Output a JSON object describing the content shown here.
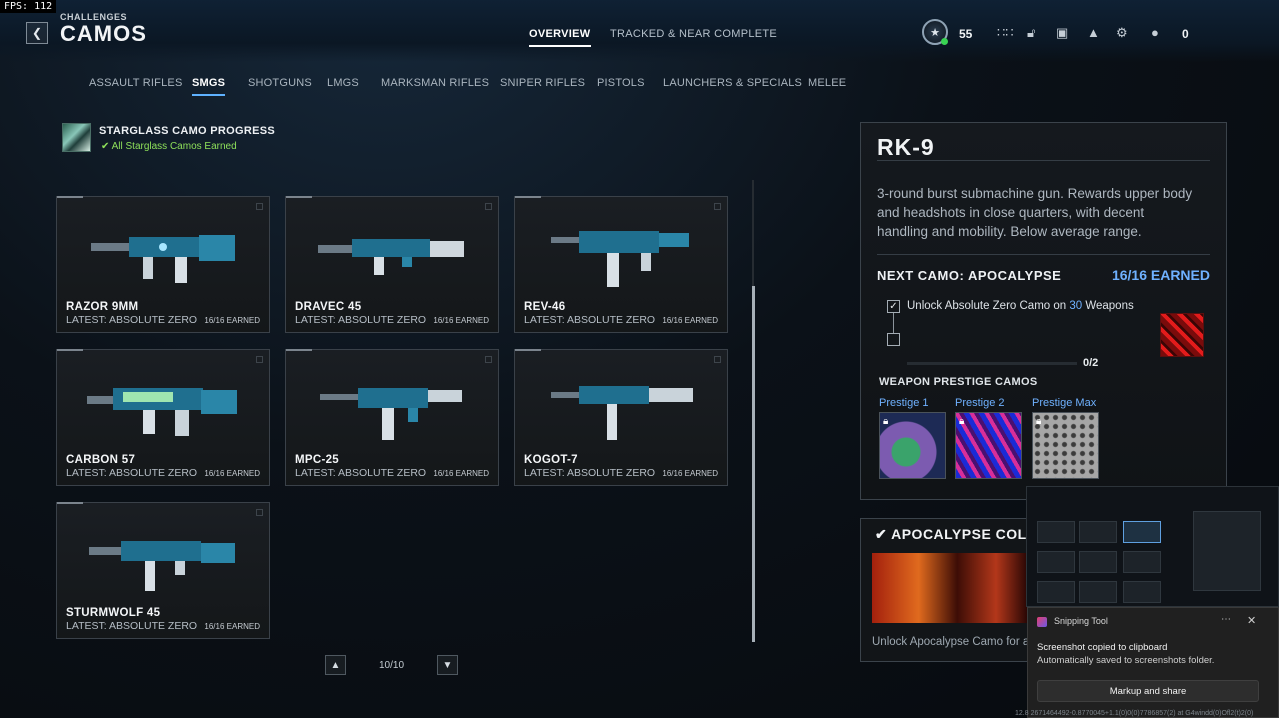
{
  "fps": "FPS: 112",
  "header": {
    "back_icon": "chevron-left-icon",
    "breadcrumb": "CHALLENGES",
    "title": "CAMOS",
    "tabs": [
      {
        "label": "OVERVIEW",
        "active": true
      },
      {
        "label": "TRACKED & NEAR COMPLETE",
        "active": false
      }
    ],
    "player_level": "55",
    "currency": "0",
    "icons": [
      "player-emblem-icon",
      "apps-grid-icon",
      "lock-open-icon",
      "camera-icon",
      "bell-icon",
      "gear-icon",
      "party-icon"
    ]
  },
  "categories": [
    {
      "label": "ASSAULT RIFLES",
      "active": false
    },
    {
      "label": "SMGS",
      "active": true
    },
    {
      "label": "SHOTGUNS",
      "active": false
    },
    {
      "label": "LMGS",
      "active": false
    },
    {
      "label": "MARKSMAN RIFLES",
      "active": false
    },
    {
      "label": "SNIPER RIFLES",
      "active": false
    },
    {
      "label": "PISTOLS",
      "active": false
    },
    {
      "label": "LAUNCHERS & SPECIALS",
      "active": false
    },
    {
      "label": "MELEE",
      "active": false
    }
  ],
  "starglass": {
    "title": "STARGLASS CAMO PROGRESS",
    "status": "All Starglass Camos Earned",
    "status_color": "#8ee05a"
  },
  "weapons": [
    {
      "name": "RAZOR 9MM",
      "latest": "LATEST: ABSOLUTE ZERO",
      "earned": "16/16 EARNED"
    },
    {
      "name": "DRAVEC 45",
      "latest": "LATEST: ABSOLUTE ZERO",
      "earned": "16/16 EARNED"
    },
    {
      "name": "REV-46",
      "latest": "LATEST: ABSOLUTE ZERO",
      "earned": "16/16 EARNED"
    },
    {
      "name": "CARBON 57",
      "latest": "LATEST: ABSOLUTE ZERO",
      "earned": "16/16 EARNED"
    },
    {
      "name": "MPC-25",
      "latest": "LATEST: ABSOLUTE ZERO",
      "earned": "16/16 EARNED"
    },
    {
      "name": "KOGOT-7",
      "latest": "LATEST: ABSOLUTE ZERO",
      "earned": "16/16 EARNED"
    },
    {
      "name": "STURMWOLF 45",
      "latest": "LATEST: ABSOLUTE ZERO",
      "earned": "16/16 EARNED"
    }
  ],
  "pagination": {
    "text": "10/10"
  },
  "detail": {
    "name": "RK-9",
    "description": "3-round burst submachine gun. Rewards upper body and headshots in close quarters, with decent handling and mobility. Below average range.",
    "next_camo_label": "NEXT CAMO: APOCALYPSE",
    "next_camo_earned": "16/16 EARNED",
    "task_prefix": "Unlock Absolute Zero Camo on ",
    "task_count": "30",
    "task_suffix": " Weapons",
    "progress_text": "0/2",
    "progress_fraction": 0,
    "prestige_title": "WEAPON PRESTIGE CAMOS",
    "prestige": [
      {
        "label": "Prestige 1"
      },
      {
        "label": "Prestige 2"
      },
      {
        "label": "Prestige Max"
      }
    ]
  },
  "collection": {
    "title": "APOCALYPSE COLLE",
    "text": "Unlock Apocalypse Camo for any"
  },
  "snipping_tool": {
    "app": "Snipping Tool",
    "line1": "Screenshot copied to clipboard",
    "line2": "Automatically saved to screenshots folder.",
    "button": "Markup and share"
  },
  "debug_coords": "12.8 2671464492-0.8770045+1.1(0)0(0)7786857(2) at G4windd(0)Ofl2(t)2(0)"
}
